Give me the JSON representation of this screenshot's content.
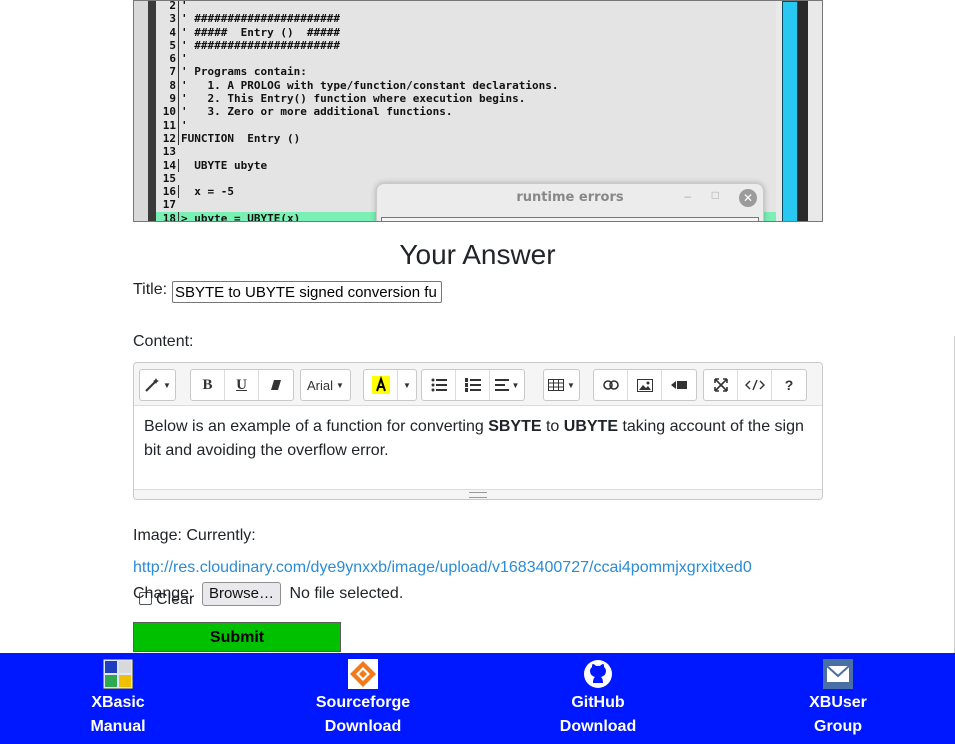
{
  "code_screenshot": {
    "lines": [
      {
        "n": "2",
        "text": "'"
      },
      {
        "n": "3",
        "text": "' ######################"
      },
      {
        "n": "4",
        "text": "' #####  Entry ()  #####"
      },
      {
        "n": "5",
        "text": "' ######################"
      },
      {
        "n": "6",
        "text": "'"
      },
      {
        "n": "7",
        "text": "' Programs contain:"
      },
      {
        "n": "8",
        "text": "'   1. A PROLOG with type/function/constant declarations."
      },
      {
        "n": "9",
        "text": "'   2. This Entry() function where execution begins."
      },
      {
        "n": "10",
        "text": "'   3. Zero or more additional functions."
      },
      {
        "n": "11",
        "text": "'"
      },
      {
        "n": "12",
        "text": "FUNCTION  Entry ()"
      },
      {
        "n": "13",
        "text": ""
      },
      {
        "n": "14",
        "text": "  UBYTE ubyte"
      },
      {
        "n": "15",
        "text": ""
      },
      {
        "n": "16",
        "text": "  x = -5"
      },
      {
        "n": "17",
        "text": ""
      },
      {
        "n": "18",
        "text": "> ubyte = UBYTE(x)"
      }
    ],
    "dialog_title": "runtime errors",
    "dialog_min": "–",
    "dialog_max": "□",
    "dialog_close": "✕"
  },
  "form": {
    "heading": "Your Answer",
    "title_label": "Title:",
    "title_value": "SBYTE to UBYTE signed conversion fu",
    "content_label": "Content:",
    "toolbar": {
      "font_name": "Arial",
      "bold": "B",
      "underline": "U",
      "help": "?"
    },
    "body_parts": [
      {
        "text": "Below is an example of a function for converting ",
        "bold": false
      },
      {
        "text": "SBYTE",
        "bold": true
      },
      {
        "text": " to ",
        "bold": false
      },
      {
        "text": "UBYTE",
        "bold": true
      },
      {
        "text": " taking account of the sign bit and avoiding the overflow error.",
        "bold": false
      }
    ],
    "image_label": "Image: Currently:",
    "image_url": "http://res.cloudinary.com/dye9ynxxb/image/upload/v1683400727/ccai4pommjxgrxitxed0",
    "clear_label": "Clear",
    "change_label": "Change:",
    "browse_label": "Browse…",
    "no_file": "No file selected.",
    "submit_label": "Submit"
  },
  "footer": {
    "items": [
      {
        "line1": "XBasic",
        "line2": "Manual",
        "icon": "xbasic-manual-icon"
      },
      {
        "line1": "Sourceforge",
        "line2": "Download",
        "icon": "sourceforge-icon"
      },
      {
        "line1": "GitHub",
        "line2": "Download",
        "icon": "github-icon"
      },
      {
        "line1": "XBUser",
        "line2": "Group",
        "icon": "mail-icon"
      }
    ]
  },
  "colors": {
    "footer_bg": "#0018ff",
    "submit_bg": "#00c000",
    "link": "#2b8bd6",
    "scroll_thumb": "#29c8f0",
    "highlight_line": "#7af0b5"
  }
}
